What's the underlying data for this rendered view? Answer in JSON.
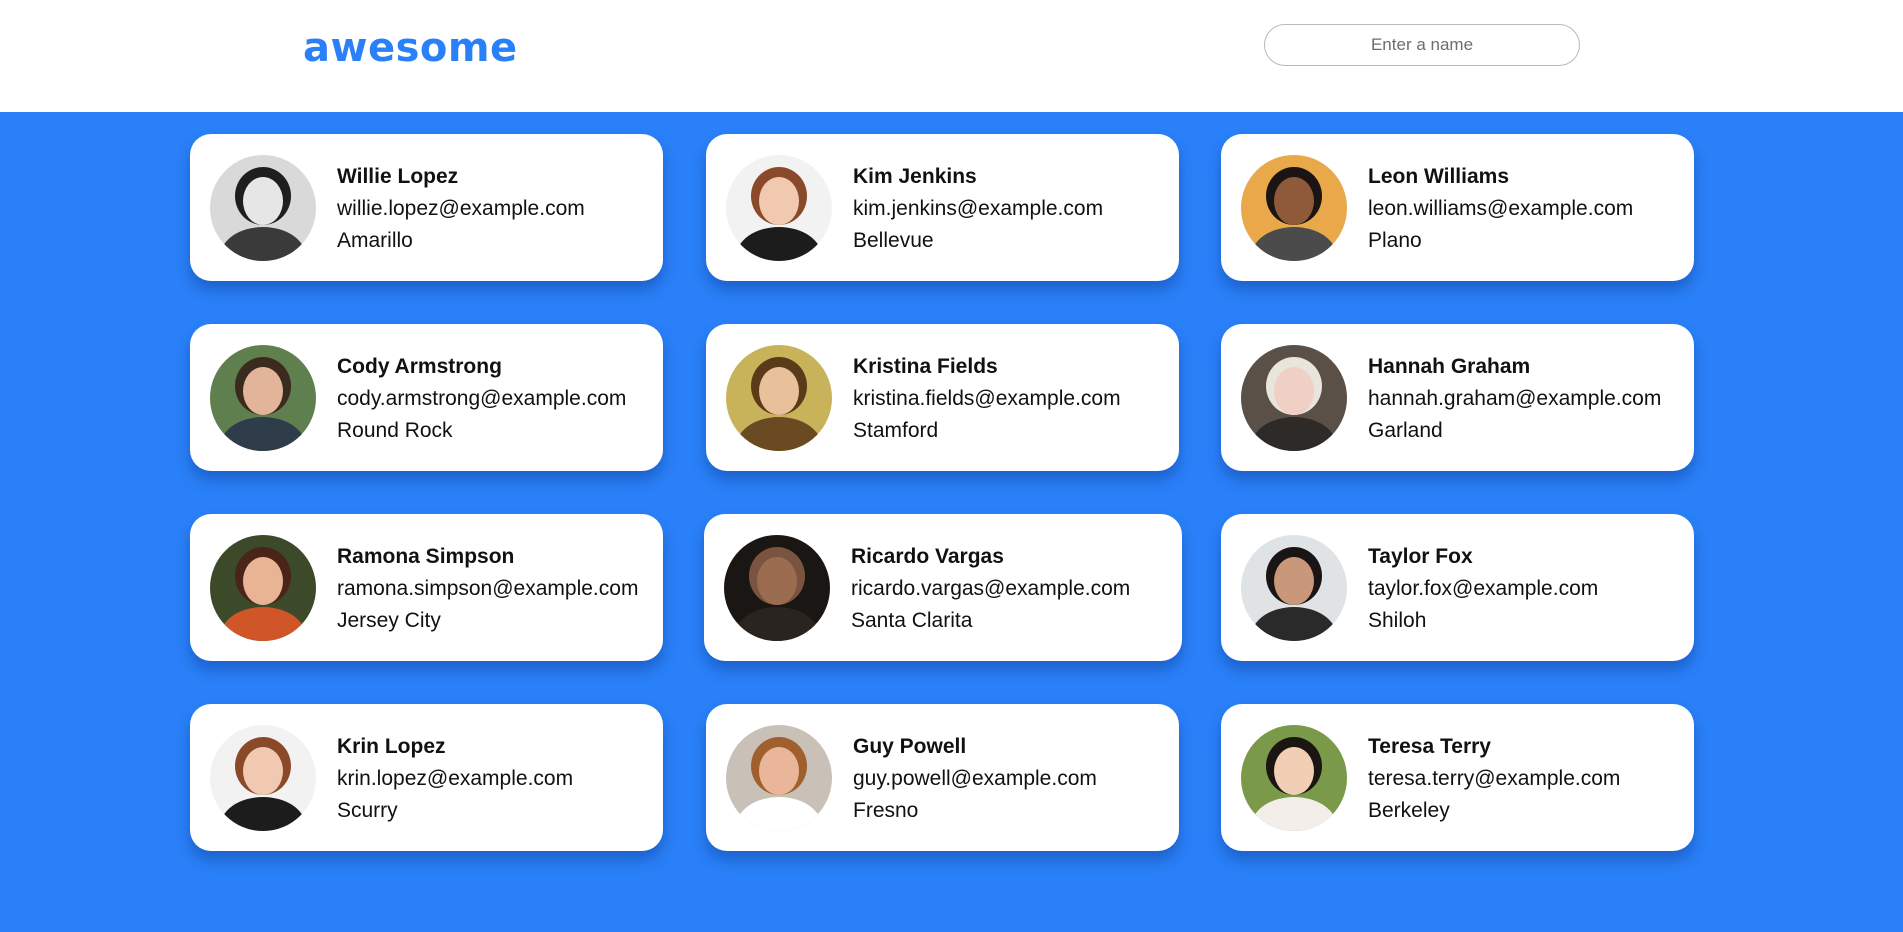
{
  "header": {
    "logo": "awesome",
    "search_placeholder": "Enter a name",
    "search_value": ""
  },
  "colors": {
    "accent": "#2a80f8",
    "card": "#ffffff"
  },
  "users": [
    {
      "name": "Willie Lopez",
      "email": "willie.lopez@example.com",
      "city": "Amarillo"
    },
    {
      "name": "Kim Jenkins",
      "email": "kim.jenkins@example.com",
      "city": "Bellevue"
    },
    {
      "name": "Leon Williams",
      "email": "leon.williams@example.com",
      "city": "Plano"
    },
    {
      "name": "Cody Armstrong",
      "email": "cody.armstrong@example.com",
      "city": "Round Rock"
    },
    {
      "name": "Kristina Fields",
      "email": "kristina.fields@example.com",
      "city": "Stamford"
    },
    {
      "name": "Hannah Graham",
      "email": "hannah.graham@example.com",
      "city": "Garland"
    },
    {
      "name": "Ramona Simpson",
      "email": "ramona.simpson@example.com",
      "city": "Jersey City"
    },
    {
      "name": "Ricardo Vargas",
      "email": "ricardo.vargas@example.com",
      "city": "Santa Clarita"
    },
    {
      "name": "Taylor Fox",
      "email": "taylor.fox@example.com",
      "city": "Shiloh"
    },
    {
      "name": "Krin Lopez",
      "email": "krin.lopez@example.com",
      "city": "Scurry"
    },
    {
      "name": "Guy Powell",
      "email": "guy.powell@example.com",
      "city": "Fresno"
    },
    {
      "name": "Teresa Terry",
      "email": "teresa.terry@example.com",
      "city": "Berkeley"
    }
  ]
}
